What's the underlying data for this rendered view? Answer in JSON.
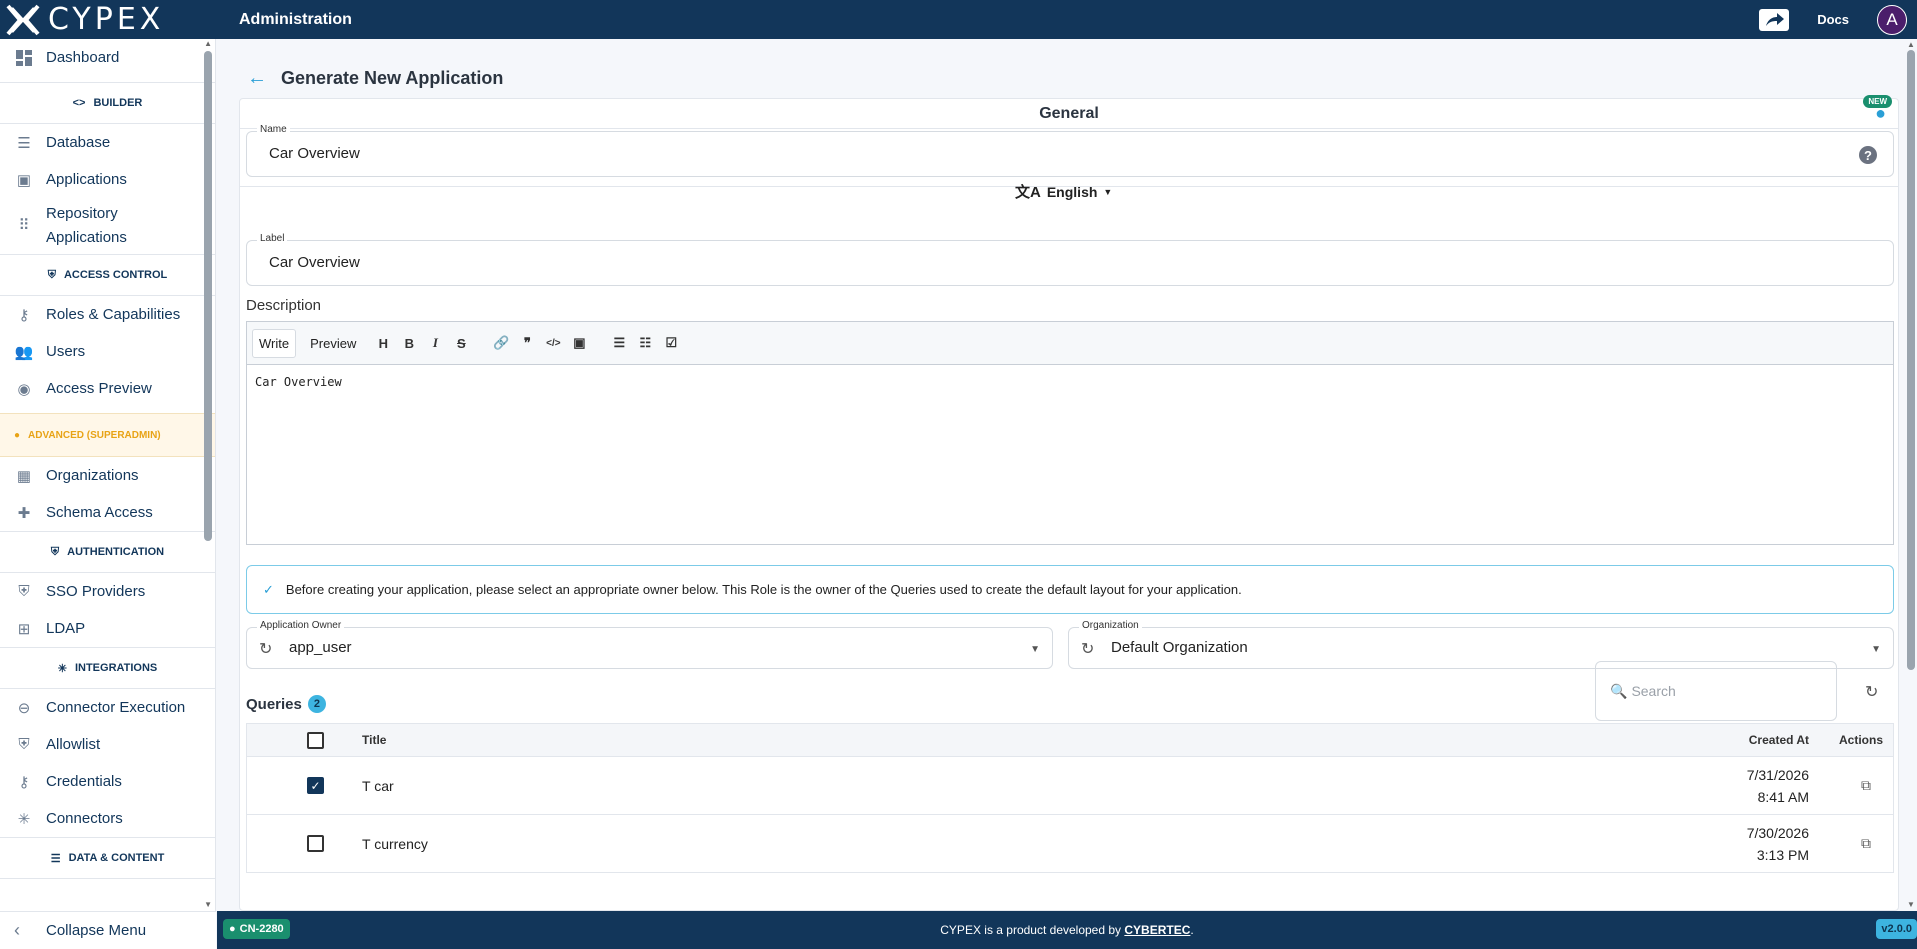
{
  "topbar": {
    "brand": "CYPEX",
    "title": "Administration",
    "docs_label": "Docs",
    "avatar_letter": "A",
    "bg_color": "#12365a"
  },
  "sidebar": {
    "dashboard": "Dashboard",
    "builder_section": "BUILDER",
    "database": "Database",
    "applications": "Applications",
    "repository_applications": "Repository Applications",
    "access_control_section": "ACCESS CONTROL",
    "roles_capabilities": "Roles & Capabilities",
    "users": "Users",
    "access_preview": "Access Preview",
    "advanced_section": "ADVANCED (SUPERADMIN)",
    "organizations": "Organizations",
    "schema_access": "Schema Access",
    "authentication_section": "AUTHENTICATION",
    "sso_providers": "SSO Providers",
    "ldap": "LDAP",
    "integrations_section": "INTEGRATIONS",
    "connector_execution": "Connector Execution",
    "allowlist": "Allowlist",
    "credentials": "Credentials",
    "connectors": "Connectors",
    "data_content_section": "DATA & CONTENT",
    "collapse_menu": "Collapse Menu"
  },
  "page": {
    "title": "Generate New Application",
    "section_title": "General",
    "new_badge": "NEW",
    "name_label": "Name",
    "name_value": "Car Overview",
    "language": "English",
    "label_label": "Label",
    "label_value": "Car Overview",
    "description_label": "Description",
    "editor": {
      "write_tab": "Write",
      "preview_tab": "Preview",
      "content": "Car Overview"
    },
    "info_text": "Before creating your application, please select an appropriate owner below. This Role is the owner of the Queries used to create the default layout for your application.",
    "owner_label": "Application Owner",
    "owner_value": "app_user",
    "org_label": "Organization",
    "org_value": "Default Organization",
    "queries_label": "Queries",
    "queries_count": "2",
    "search_placeholder": "Search"
  },
  "table": {
    "headers": {
      "title": "Title",
      "created_at": "Created At",
      "actions": "Actions"
    },
    "rows": [
      {
        "title": "T car",
        "date": "7/31/2026",
        "time": "8:41 AM",
        "checked": true
      },
      {
        "title": "T currency",
        "date": "7/30/2026",
        "time": "3:13 PM",
        "checked": false
      }
    ]
  },
  "footer": {
    "branch": "CN-2280",
    "text_prefix": "CYPEX is a product developed by ",
    "company": "CYBERTEC",
    "text_suffix": ".",
    "version": "v2.0.0"
  }
}
